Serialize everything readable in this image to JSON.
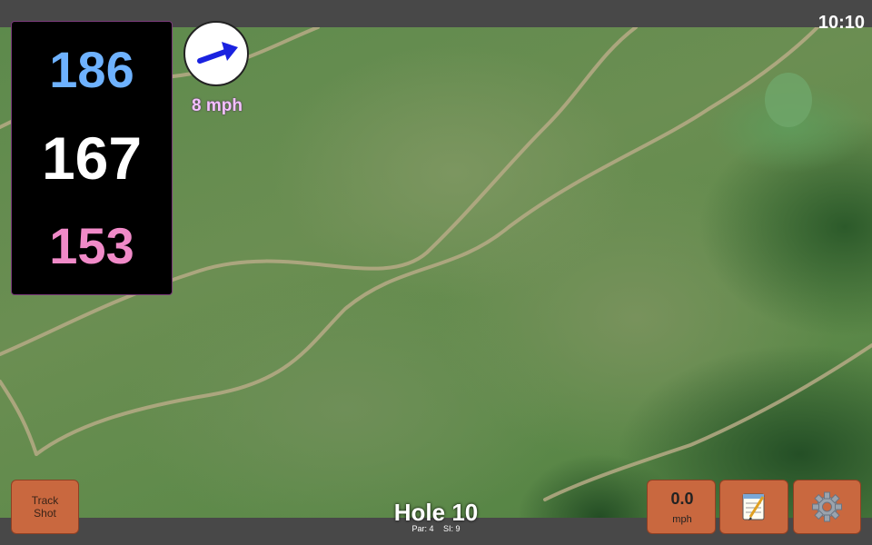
{
  "status": {
    "clock": "10:10"
  },
  "yardage": {
    "back": "186",
    "middle": "167",
    "front": "153"
  },
  "wind": {
    "speed_label": "8 mph",
    "direction_icon": "arrow-icon"
  },
  "buttons": {
    "track_shot_line1": "Track",
    "track_shot_line2": "Shot",
    "speed_value": "0.0",
    "speed_unit": "mph",
    "notes_icon": "notepad-icon",
    "settings_icon": "gear-icon"
  },
  "hole": {
    "title": "Hole 10",
    "par": "Par: 4",
    "si": "SI: 9"
  },
  "colors": {
    "back": "#6eb2ff",
    "middle": "#ffffff",
    "front": "#f08ac8",
    "button": "#c9683f"
  }
}
